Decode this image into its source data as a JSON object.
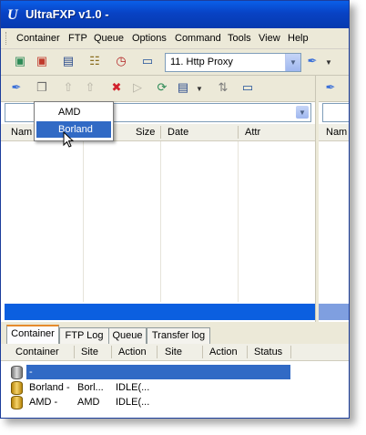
{
  "window": {
    "title": "UltraFXP v1.0  -",
    "app_icon": "ultrafxp-logo-icon"
  },
  "menu": [
    "Container",
    "FTP",
    "Queue",
    "Options",
    "Command",
    "Tools",
    "View",
    "Help"
  ],
  "toolbar": {
    "site_combo": {
      "value": "11. Http Proxy"
    }
  },
  "left_pane": {
    "columns": [
      "Nam",
      "Size",
      "Date",
      "Attr"
    ],
    "dropdown": {
      "items": [
        "AMD",
        "Borland"
      ],
      "selected": "Borland"
    }
  },
  "right_pane": {
    "columns": [
      "Nam"
    ]
  },
  "tabs": [
    {
      "label": "Container",
      "active": true
    },
    {
      "label": "FTP Log",
      "active": false
    },
    {
      "label": "Queue",
      "active": false
    },
    {
      "label": "Transfer log",
      "active": false
    }
  ],
  "queue": {
    "columns": [
      "Container",
      "Site",
      "Action",
      "Site",
      "Action",
      "Status"
    ],
    "rows": [
      {
        "container": "-",
        "site": "",
        "action": "",
        "selected": true
      },
      {
        "container": "Borland -",
        "site": "Borl...",
        "action": "IDLE(..."
      },
      {
        "container": "AMD -",
        "site": "AMD",
        "action": "IDLE(..."
      }
    ]
  },
  "colors": {
    "title_bar": "#0842c4",
    "selection": "#316ac5",
    "status_bar": "#0b5fe0",
    "active_tab_accent": "#e68b2c"
  }
}
